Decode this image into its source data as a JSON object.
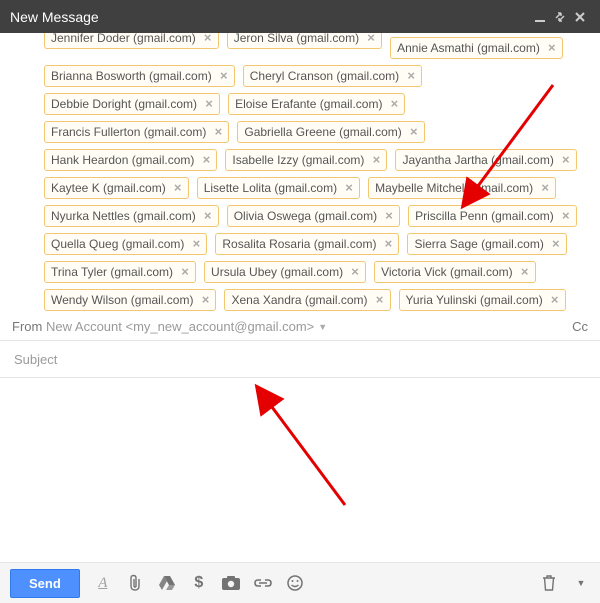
{
  "titlebar": {
    "title": "New Message"
  },
  "recipients": [
    {
      "label": "Jennifer Doder (gmail.com)",
      "cut": true
    },
    {
      "label": "Jeron Silva (gmail.com)",
      "cut": true
    },
    {
      "label": "Annie Asmathi (gmail.com)"
    },
    {
      "label": "Brianna Bosworth (gmail.com)"
    },
    {
      "label": "Cheryl Cranson (gmail.com)"
    },
    {
      "label": "Debbie Doright (gmail.com)"
    },
    {
      "label": "Eloise Erafante (gmail.com)"
    },
    {
      "label": "Francis Fullerton (gmail.com)"
    },
    {
      "label": "Gabriella Greene (gmail.com)"
    },
    {
      "label": "Hank Heardon (gmail.com)"
    },
    {
      "label": "Isabelle Izzy (gmail.com)"
    },
    {
      "label": "Jayantha Jartha (gmail.com)"
    },
    {
      "label": "Kaytee K (gmail.com)"
    },
    {
      "label": "Lisette Lolita (gmail.com)"
    },
    {
      "label": "Maybelle Mitchell (gmail.com)"
    },
    {
      "label": "Nyurka Nettles (gmail.com)"
    },
    {
      "label": "Olivia Oswega (gmail.com)"
    },
    {
      "label": "Priscilla Penn (gmail.com)"
    },
    {
      "label": "Quella Queg (gmail.com)"
    },
    {
      "label": "Rosalita Rosaria (gmail.com)"
    },
    {
      "label": "Sierra Sage (gmail.com)"
    },
    {
      "label": "Trina Tyler (gmail.com)"
    },
    {
      "label": "Ursula Ubey (gmail.com)"
    },
    {
      "label": "Victoria Vick (gmail.com)"
    },
    {
      "label": "Wendy Wilson (gmail.com)"
    },
    {
      "label": "Xena Xandra (gmail.com)"
    },
    {
      "label": "Yuria Yulinski (gmail.com)"
    }
  ],
  "from": {
    "label": "From",
    "value": "New Account <my_new_account@gmail.com>",
    "cc_label": "Cc"
  },
  "subject": {
    "placeholder": "Subject",
    "value": ""
  },
  "toolbar": {
    "send_label": "Send"
  }
}
